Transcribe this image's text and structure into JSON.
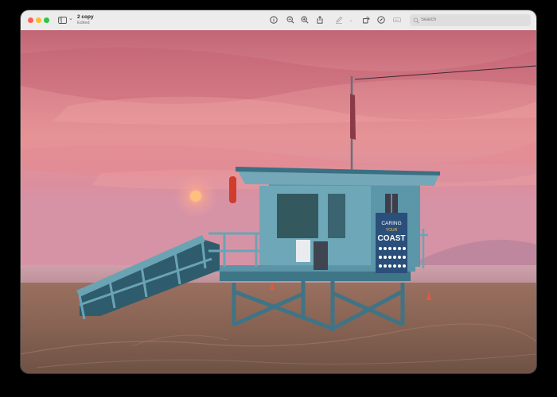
{
  "window": {
    "title": "2 copy",
    "subtitle": "Edited"
  },
  "toolbar": {
    "icons": [
      "sidebar-icon",
      "chevron-down-icon",
      "info-icon",
      "zoom-out-icon",
      "zoom-in-icon",
      "share-icon",
      "markup-pen-icon",
      "chevron-down-icon",
      "rotate-icon",
      "markup-circle-icon",
      "edit-signature-icon",
      "search-icon"
    ],
    "search_placeholder": "Search"
  },
  "colors": {
    "sky_top": "#c96a76",
    "sky_mid": "#e59096",
    "sky_low": "#d58a9a",
    "sun": "#ffb37a",
    "sea": "#c79aa4",
    "sand": "#8a6656",
    "tower": "#5e96a8",
    "tower_dark": "#3b6f82"
  },
  "image": {
    "description_icon": "photo-lifeguard-tower",
    "sign_lines": [
      "CARING",
      "YOUR",
      "COAST"
    ]
  }
}
